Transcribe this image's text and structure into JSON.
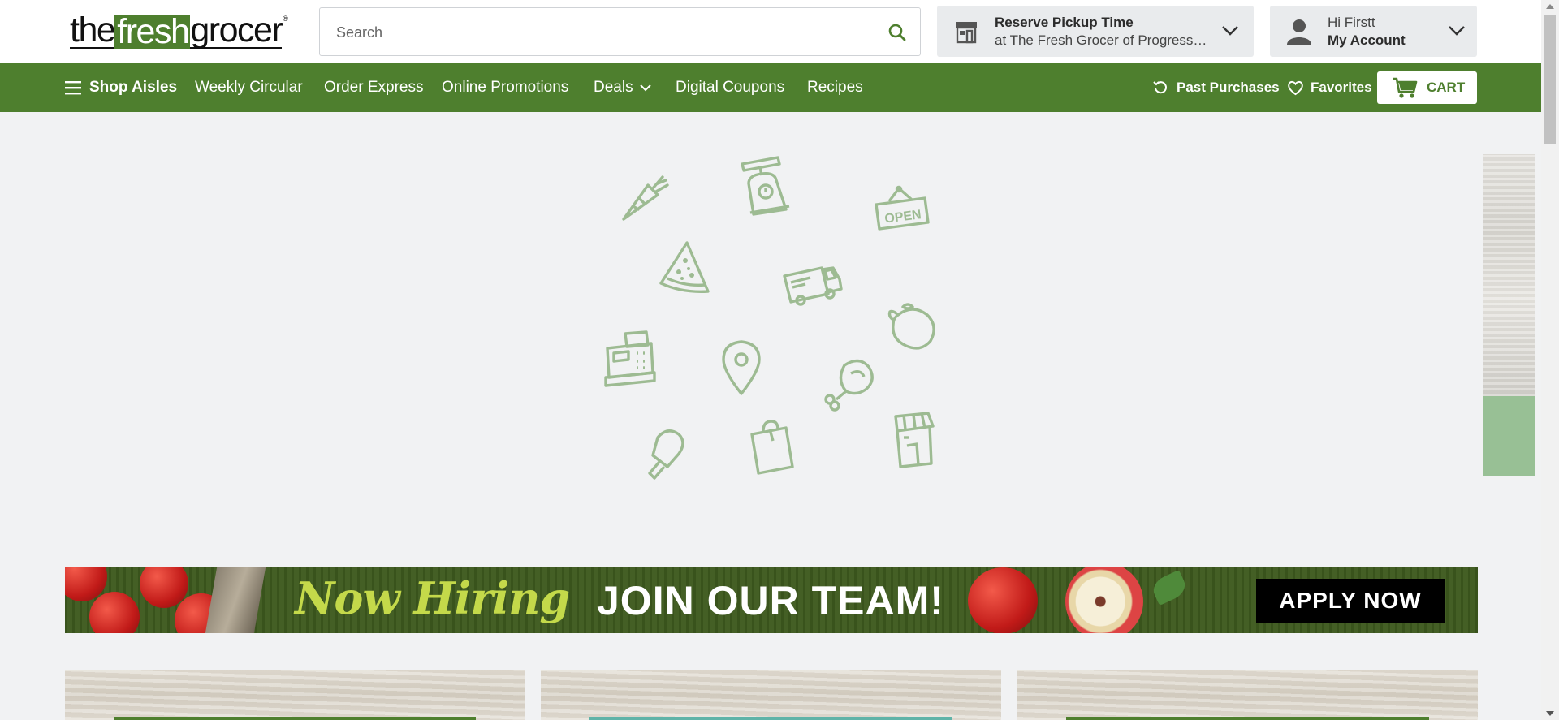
{
  "header": {
    "logo": {
      "the": "the",
      "fresh": "fresh",
      "grocer": "grocer",
      "reg": "®"
    },
    "search": {
      "placeholder": "Search",
      "icon": "search-icon"
    },
    "pickup": {
      "title": "Reserve Pickup Time",
      "store": "at The Fresh Grocer of Progress Plaza",
      "icon": "store-icon"
    },
    "account": {
      "greeting": "Hi Firstt",
      "label": "My Account",
      "icon": "user-icon"
    }
  },
  "nav": {
    "shop_aisles": "Shop Aisles",
    "weekly_circular": "Weekly Circular",
    "order_express": "Order Express",
    "online_promotions": "Online Promotions",
    "deals": "Deals",
    "digital_coupons": "Digital Coupons",
    "recipes": "Recipes",
    "past_purchases": "Past Purchases",
    "favorites": "Favorites",
    "cart": "CART"
  },
  "loader": {
    "icons": [
      "carrot-icon",
      "scale-icon",
      "open-sign-icon",
      "pizza-icon",
      "delivery-truck-icon",
      "lemon-icon",
      "cash-register-icon",
      "location-pin-icon",
      "meat-drumstick-icon",
      "popsicle-icon",
      "shopping-bag-icon",
      "storefront-icon"
    ],
    "open_sign_text": "OPEN"
  },
  "banner": {
    "headline": "Now Hiring",
    "subhead": "JOIN OUR TEAM!",
    "cta": "APPLY NOW"
  },
  "colors": {
    "brand_green": "#4e7f2e",
    "loader_icon": "#9dbb92",
    "banner_headline": "#c4d94a"
  }
}
